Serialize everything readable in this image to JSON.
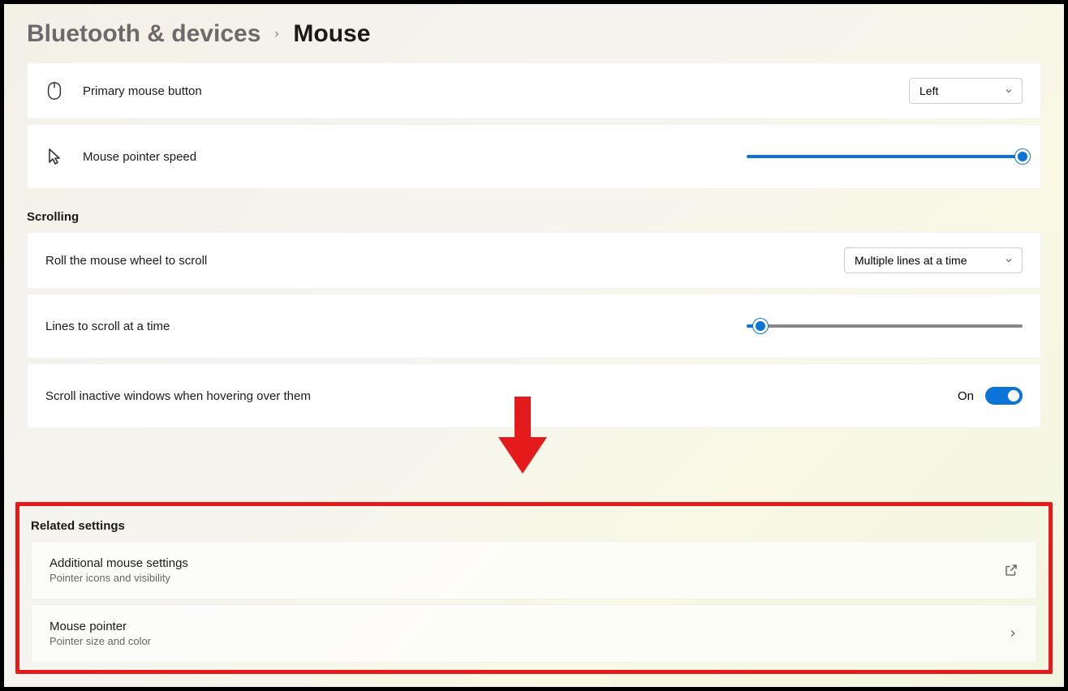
{
  "breadcrumb": {
    "parent": "Bluetooth & devices",
    "current": "Mouse"
  },
  "primary_button": {
    "label": "Primary mouse button",
    "value": "Left"
  },
  "pointer_speed": {
    "label": "Mouse pointer speed",
    "value_percent": 100
  },
  "sections": {
    "scrolling": "Scrolling",
    "related": "Related settings"
  },
  "scroll_mode": {
    "label": "Roll the mouse wheel to scroll",
    "value": "Multiple lines at a time"
  },
  "lines_to_scroll": {
    "label": "Lines to scroll at a time",
    "value_percent": 5
  },
  "scroll_inactive": {
    "label": "Scroll inactive windows when hovering over them",
    "state_label": "On",
    "on": true
  },
  "related": {
    "additional": {
      "title": "Additional mouse settings",
      "sub": "Pointer icons and visibility"
    },
    "pointer": {
      "title": "Mouse pointer",
      "sub": "Pointer size and color"
    }
  },
  "annotation": {
    "arrow_color": "#e51a1a",
    "highlight_color": "#e51a1a"
  }
}
